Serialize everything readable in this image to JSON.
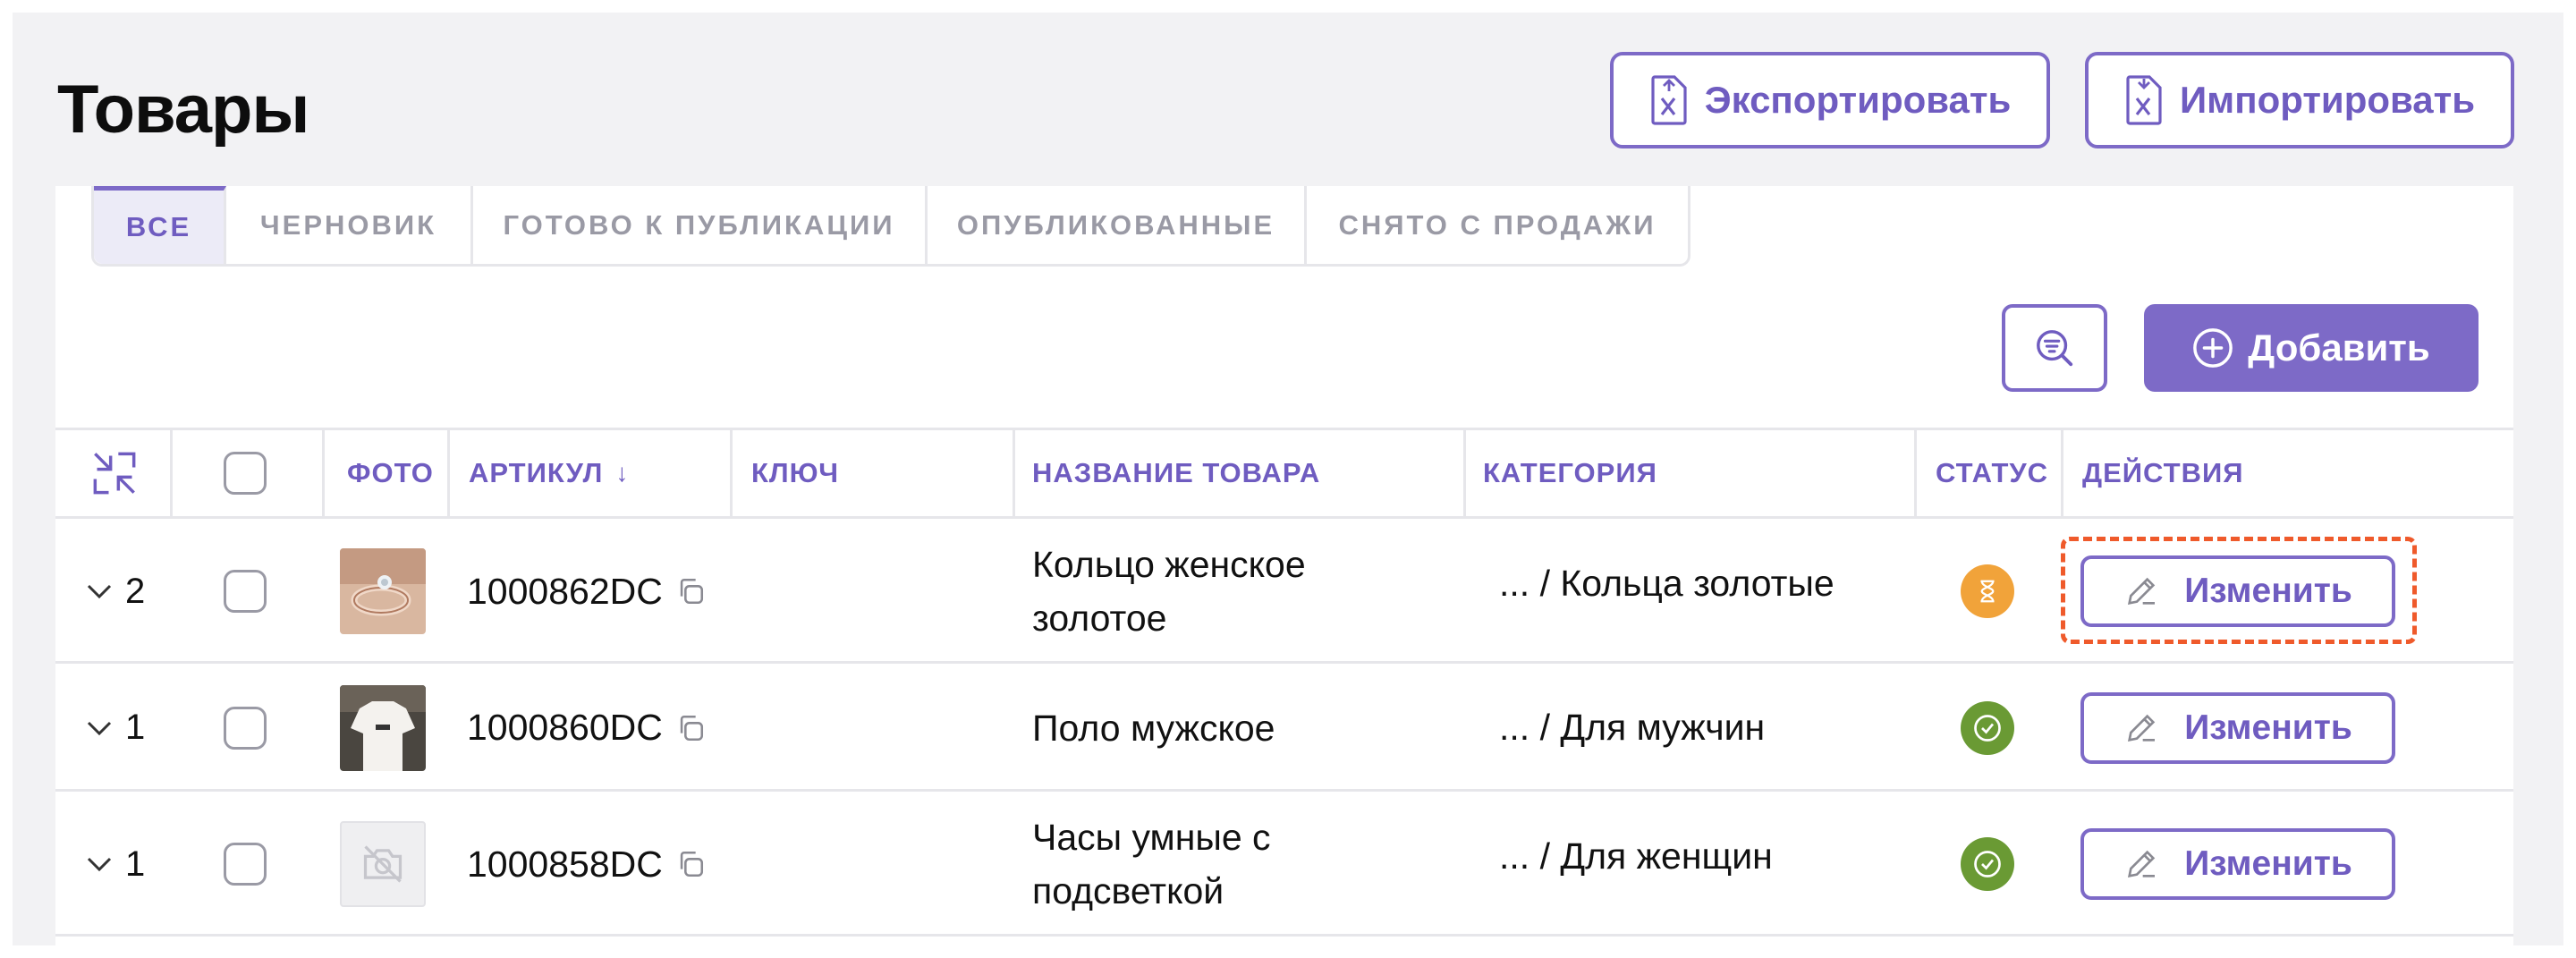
{
  "page": {
    "title": "Товары"
  },
  "header": {
    "export_label": "Экспортировать",
    "import_label": "Импортировать"
  },
  "tabs": [
    {
      "label": "ВСЕ",
      "active": true
    },
    {
      "label": "ЧЕРНОВИК",
      "active": false
    },
    {
      "label": "ГОТОВО К ПУБЛИКАЦИИ",
      "active": false
    },
    {
      "label": "ОПУБЛИКОВАННЫЕ",
      "active": false
    },
    {
      "label": "СНЯТО С ПРОДАЖИ",
      "active": false
    }
  ],
  "toolbar": {
    "filter_icon": "filter-search-icon",
    "add_label": "Добавить"
  },
  "table": {
    "columns": {
      "photo": "ФОТО",
      "sku": "АРТИКУЛ",
      "key": "КЛЮЧ",
      "name": "НАЗВАНИЕ ТОВАРА",
      "category": "КАТЕГОРИЯ",
      "status": "СТАТУС",
      "actions": "ДЕЙСТВИЯ"
    },
    "sort_indicator": "↓",
    "rows": [
      {
        "count": "2",
        "photo": "ring-photo",
        "sku": "1000862DC",
        "key": "",
        "name_line1": "Кольцо женское",
        "name_line2": "золотое",
        "category": "... / Кольца золотые",
        "status": "pending",
        "action_label": "Изменить"
      },
      {
        "count": "1",
        "photo": "polo-photo",
        "sku": "1000860DC",
        "key": "",
        "name_line1": "Поло мужское",
        "name_line2": "",
        "category": "... / Для мужчин",
        "status": "published",
        "action_label": "Изменить"
      },
      {
        "count": "1",
        "photo": "no-photo",
        "sku": "1000858DC",
        "key": "",
        "name_line1": "Часы умные с",
        "name_line2": "подсветкой",
        "category": "... / Для женщин",
        "status": "published",
        "action_label": "Изменить"
      }
    ]
  },
  "colors": {
    "accent": "#7d6ac7",
    "status_pending": "#f1a33a",
    "status_published": "#6a9a34",
    "focus": "#ef5a2b"
  }
}
